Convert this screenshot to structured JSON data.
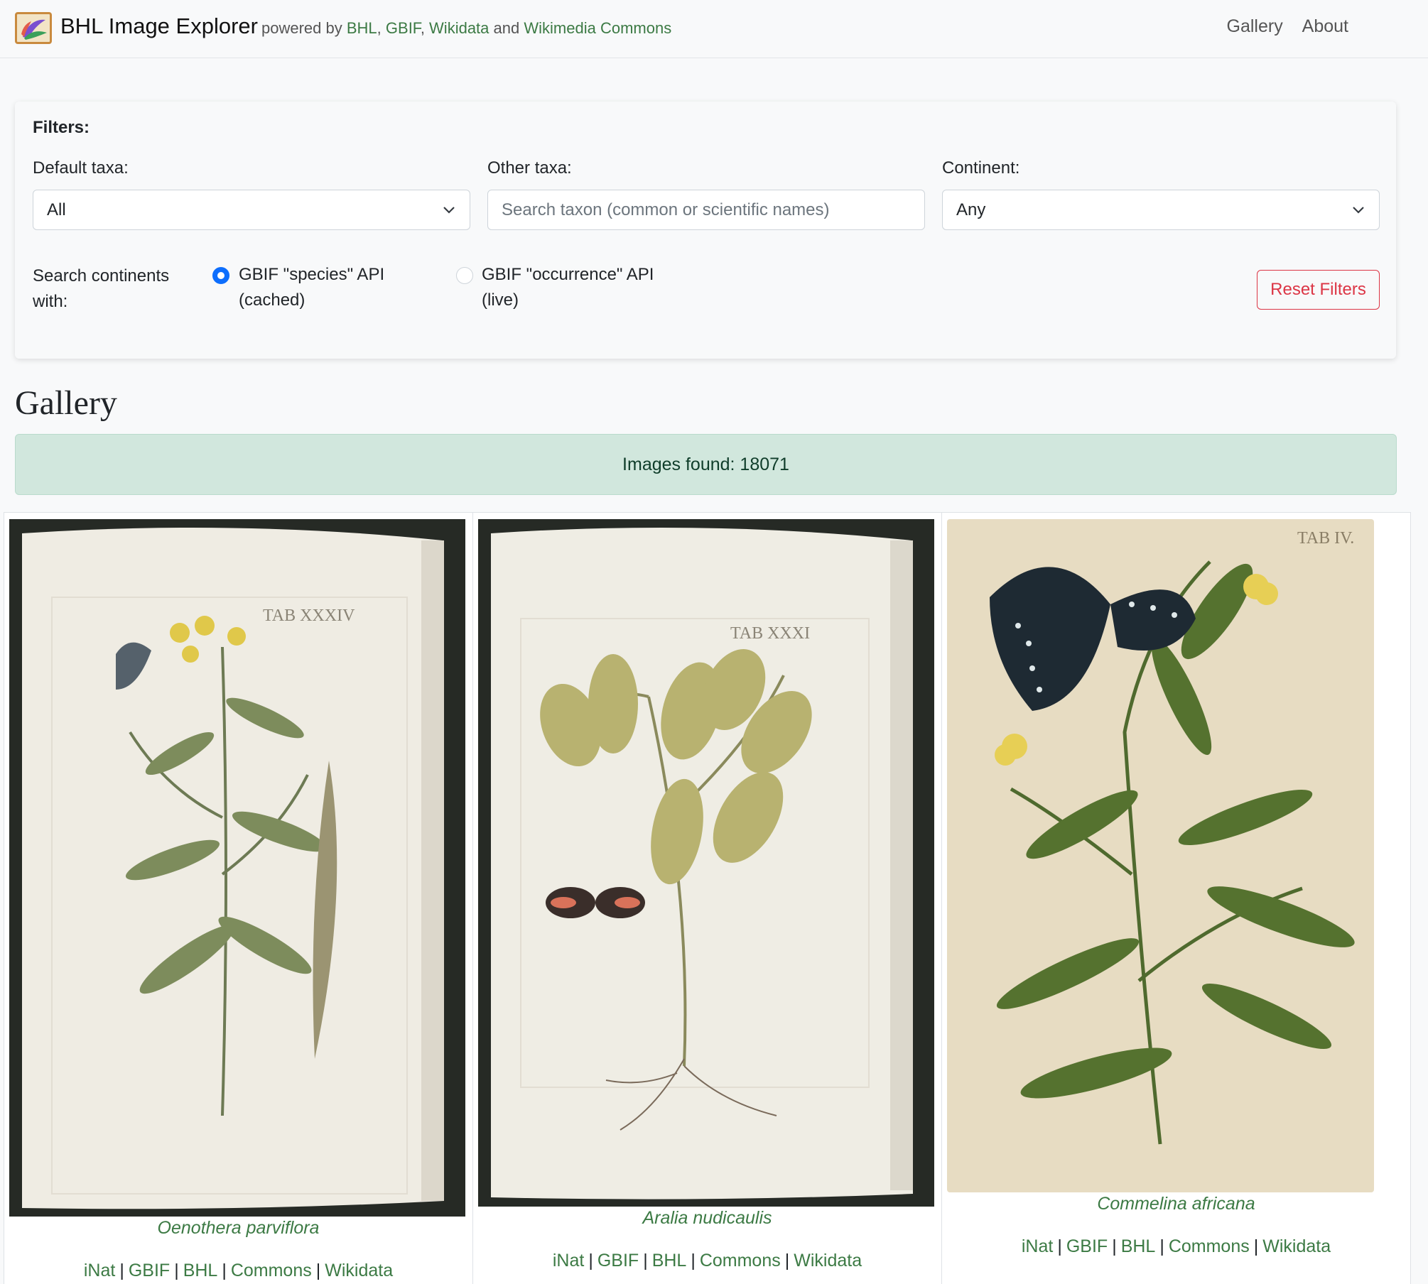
{
  "navbar": {
    "brand": "BHL Image Explorer",
    "powered_prefix": "powered by",
    "powered_links": [
      "BHL",
      "GBIF",
      "Wikidata",
      "Wikimedia Commons"
    ],
    "powered_and": "and",
    "nav_items": [
      "Gallery",
      "About"
    ]
  },
  "filters": {
    "title": "Filters:",
    "default_taxa_label": "Default taxa:",
    "default_taxa_value": "All",
    "other_taxa_label": "Other taxa:",
    "other_taxa_placeholder": "Search taxon (common or scientific names)",
    "continent_label": "Continent:",
    "continent_value": "Any",
    "search_with_label": "Search continents with:",
    "radio_species": "GBIF \"species\" API (cached)",
    "radio_occurrence": "GBIF \"occurrence\" API (live)",
    "radio_selected": "species",
    "reset_label": "Reset Filters"
  },
  "gallery": {
    "title": "Gallery",
    "images_found": "Images found: 18071",
    "items": [
      {
        "name": "Oenothera parviflora",
        "plate": "TAB XXXIV",
        "links": [
          "iNat",
          "GBIF",
          "BHL",
          "Commons",
          "Wikidata"
        ]
      },
      {
        "name": "Aralia nudicaulis",
        "plate": "TAB XXXI",
        "links": [
          "iNat",
          "GBIF",
          "BHL",
          "Commons",
          "Wikidata"
        ]
      },
      {
        "name": "Commelina africana",
        "plate": "TAB IV.",
        "links": [
          "iNat",
          "GBIF",
          "BHL",
          "Commons",
          "Wikidata"
        ]
      }
    ]
  },
  "colors": {
    "link_green": "#3c7a44",
    "banner_green": "#d1e7dd",
    "reset_red": "#dc3545",
    "radio_blue": "#0d6efd"
  }
}
